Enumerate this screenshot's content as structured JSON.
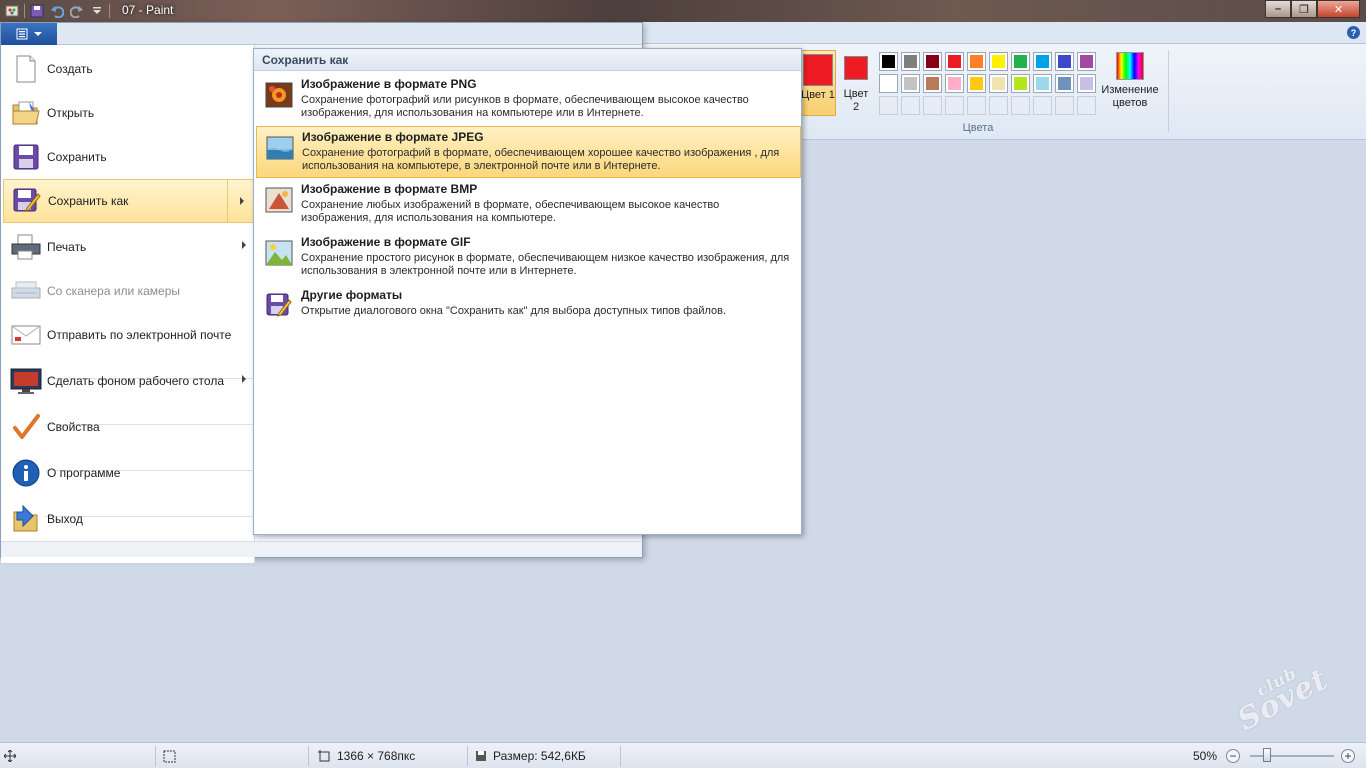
{
  "window": {
    "title": "07 - Paint",
    "minimize_glyph": "–",
    "maximize_glyph": "❐",
    "close_glyph": "✕"
  },
  "ribbon": {
    "help_glyph": "?",
    "color1_label": "Цвет 1",
    "color2_label": "Цвет 2",
    "colors_group_label": "Цвета",
    "edit_colors_label": "Изменение цветов",
    "color1": "#ed1c24",
    "color2": "#ed1c24",
    "palette_row1": [
      "#000000",
      "#7f7f7f",
      "#880015",
      "#ed1c24",
      "#ff7f27",
      "#fff200",
      "#22b14c",
      "#00a2e8",
      "#3f48cc",
      "#a349a4"
    ],
    "palette_row2": [
      "#ffffff",
      "#c3c3c3",
      "#b97a57",
      "#ffaec9",
      "#ffc90e",
      "#efe4b0",
      "#b5e61d",
      "#99d9ea",
      "#7092be",
      "#c8bfe7"
    ]
  },
  "menu": {
    "items": [
      {
        "label": "Создать",
        "icon": "new-document-icon"
      },
      {
        "label": "Открыть",
        "icon": "open-folder-icon"
      },
      {
        "label": "Сохранить",
        "icon": "save-icon"
      },
      {
        "label": "Сохранить как",
        "icon": "save-as-icon"
      },
      {
        "label": "Печать",
        "icon": "printer-icon"
      },
      {
        "label": "Со сканера или камеры",
        "icon": "scanner-icon"
      },
      {
        "label": "Отправить по электронной почте",
        "icon": "email-icon"
      },
      {
        "label": "Сделать фоном рабочего стола",
        "icon": "desktop-background-icon"
      },
      {
        "label": "Свойства",
        "icon": "properties-checkmark-icon"
      },
      {
        "label": "О программе",
        "icon": "info-icon"
      },
      {
        "label": "Выход",
        "icon": "exit-icon"
      }
    ]
  },
  "submenu": {
    "title": "Сохранить как",
    "items": [
      {
        "title": "Изображение в формате PNG",
        "desc": "Сохранение фотографий или рисунков в формате, обеспечивающем высокое качество изображения, для использования на компьютере или в Интернете."
      },
      {
        "title": "Изображение в формате JPEG",
        "desc": "Сохранение фотографий в формате, обеспечивающем хорошее качество изображения , для использования на компьютере, в электронной почте или в Интернете."
      },
      {
        "title": "Изображение в формате BMP",
        "desc": "Сохранение любых изображений в формате, обеспечивающем высокое качество изображения, для использования на компьютере."
      },
      {
        "title": "Изображение в формате GIF",
        "desc": "Сохранение простого рисунок в формате, обеспечивающем низкое качество изображения, для использования в электронной почте или в Интернете."
      },
      {
        "title": "Другие форматы",
        "desc": "Открытие диалогового окна \"Сохранить как\" для выбора доступных типов файлов."
      }
    ]
  },
  "statusbar": {
    "dimensions": "1366 × 768пкс",
    "size": "Размер: 542,6КБ",
    "zoom": "50%",
    "zoom_level": 0.2
  },
  "watermark": {
    "line1": "club",
    "line2": "Sovet"
  }
}
